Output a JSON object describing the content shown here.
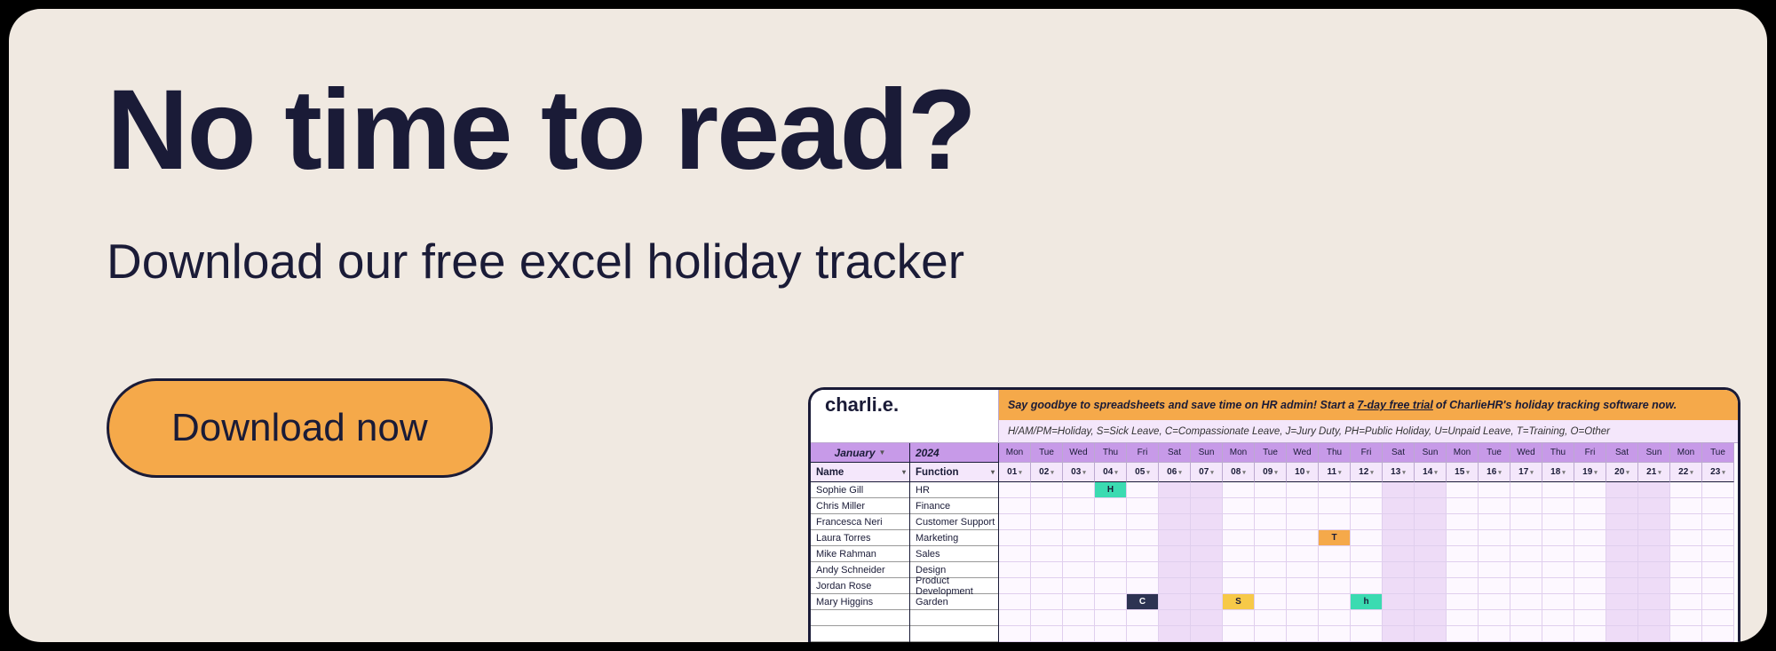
{
  "card": {
    "title": "No time to read?",
    "subtitle": "Download our free excel holiday tracker",
    "cta_label": "Download now"
  },
  "sheet": {
    "brand": "charli.e.",
    "banner_prefix": "Say goodbye to spreadsheets and save time on HR admin! Start a",
    "banner_underline": "7-day free trial",
    "banner_suffix": "of CharlieHR's holiday tracking software now.",
    "legend": "H/AM/PM=Holiday, S=Sick Leave, C=Compassionate Leave, J=Jury Duty, PH=Public Holiday, U=Unpaid Leave, T=Training, O=Other",
    "month_label": "January",
    "year_label": "2024",
    "name_header": "Name",
    "func_header": "Function",
    "employees": [
      {
        "name": "Sophie Gill",
        "func": "HR"
      },
      {
        "name": "Chris Miller",
        "func": "Finance"
      },
      {
        "name": "Francesca Neri",
        "func": "Customer Support"
      },
      {
        "name": "Laura Torres",
        "func": "Marketing"
      },
      {
        "name": "Mike Rahman",
        "func": "Sales"
      },
      {
        "name": "Andy Schneider",
        "func": "Design"
      },
      {
        "name": "Jordan Rose",
        "func": "Product Development"
      },
      {
        "name": "Mary Higgins",
        "func": "Garden"
      },
      {
        "name": "",
        "func": ""
      },
      {
        "name": "",
        "func": ""
      }
    ],
    "days": [
      {
        "dow": "Mon",
        "num": "01"
      },
      {
        "dow": "Tue",
        "num": "02"
      },
      {
        "dow": "Wed",
        "num": "03"
      },
      {
        "dow": "Thu",
        "num": "04"
      },
      {
        "dow": "Fri",
        "num": "05"
      },
      {
        "dow": "Sat",
        "num": "06"
      },
      {
        "dow": "Sun",
        "num": "07"
      },
      {
        "dow": "Mon",
        "num": "08"
      },
      {
        "dow": "Tue",
        "num": "09"
      },
      {
        "dow": "Wed",
        "num": "10"
      },
      {
        "dow": "Thu",
        "num": "11"
      },
      {
        "dow": "Fri",
        "num": "12"
      },
      {
        "dow": "Sat",
        "num": "13"
      },
      {
        "dow": "Sun",
        "num": "14"
      },
      {
        "dow": "Mon",
        "num": "15"
      },
      {
        "dow": "Tue",
        "num": "16"
      },
      {
        "dow": "Wed",
        "num": "17"
      },
      {
        "dow": "Thu",
        "num": "18"
      },
      {
        "dow": "Fri",
        "num": "19"
      },
      {
        "dow": "Sat",
        "num": "20"
      },
      {
        "dow": "Sun",
        "num": "21"
      },
      {
        "dow": "Mon",
        "num": "22"
      },
      {
        "dow": "Tue",
        "num": "23"
      }
    ],
    "marks": {
      "0": {
        "3": "H"
      },
      "3": {
        "10": "T"
      },
      "7": {
        "4": "C",
        "7": "S",
        "11": "h"
      }
    }
  }
}
